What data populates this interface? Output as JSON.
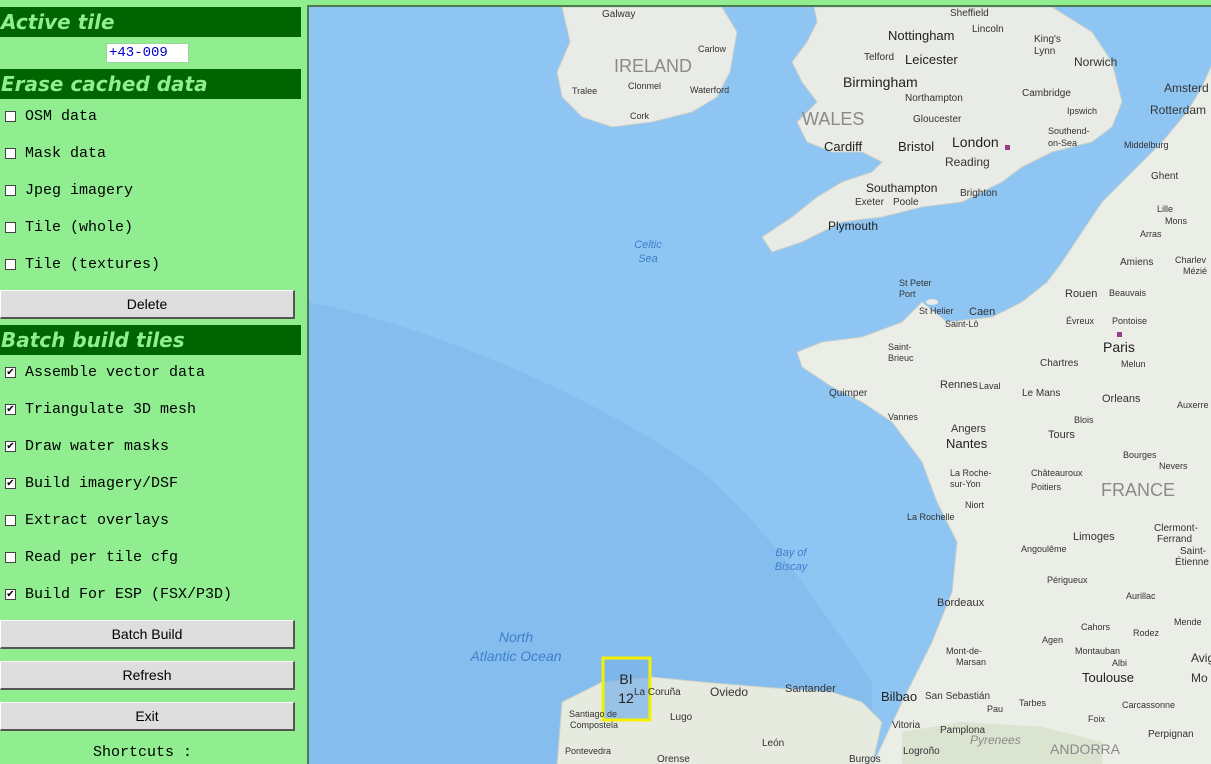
{
  "sidebar": {
    "active_tile": {
      "header": "Active tile",
      "value": "+43-009"
    },
    "erase": {
      "header": "Erase cached data",
      "options": [
        {
          "label": "OSM data",
          "checked": false
        },
        {
          "label": "Mask data",
          "checked": false
        },
        {
          "label": "Jpeg imagery",
          "checked": false
        },
        {
          "label": "Tile (whole)",
          "checked": false
        },
        {
          "label": "Tile (textures)",
          "checked": false
        }
      ],
      "delete_label": "Delete"
    },
    "batch": {
      "header": "Batch build tiles",
      "options": [
        {
          "label": "Assemble vector data",
          "checked": true
        },
        {
          "label": "Triangulate 3D mesh",
          "checked": true
        },
        {
          "label": "Draw water masks",
          "checked": true
        },
        {
          "label": "Build imagery/DSF",
          "checked": true
        },
        {
          "label": "Extract overlays",
          "checked": false
        },
        {
          "label": "Read per tile cfg",
          "checked": false
        },
        {
          "label": "Build For ESP (FSX/P3D)",
          "checked": true
        }
      ],
      "batch_build_label": "Batch Build",
      "refresh_label": "Refresh",
      "exit_label": "Exit"
    },
    "shortcuts_label": "Shortcuts :"
  },
  "map": {
    "selected_tile": {
      "line1": "BI",
      "line2": "12"
    },
    "water_labels": {
      "celtic1": "Celtic",
      "celtic2": "Sea",
      "biscay1": "Bay of",
      "biscay2": "Biscay",
      "atlantic1": "North",
      "atlantic2": "Atlantic Ocean"
    },
    "country_labels": {
      "ireland": "IRELAND",
      "wales": "WALES",
      "france": "FRANCE",
      "andorra": "ANDORRA"
    },
    "region_labels": {
      "pyrenees": "Pyrenees"
    },
    "cities_big": {
      "london": "London",
      "birmingham": "Birmingham",
      "paris": "Paris",
      "nantes": "Nantes",
      "bilbao": "Bilbao",
      "toulouse": "Toulouse",
      "nottingham": "Nottingham",
      "leicester": "Leicester",
      "cardiff": "Cardiff",
      "bristol": "Bristol",
      "southampton": "Southampton",
      "plymouth": "Plymouth",
      "reading": "Reading",
      "rouen": "Rouen",
      "bordeaux": "Bordeaux",
      "rennes": "Rennes",
      "caen": "Caen",
      "orleans": "Orleans",
      "tours": "Tours",
      "limoges": "Limoges",
      "oviedo": "Oviedo",
      "santander": "Santander",
      "norwich": "Norwich",
      "angers": "Angers",
      "amsterdam": "Amsterd",
      "rotterdam": "Rotterdam",
      "mo": "Mo",
      "avig": "Avig"
    },
    "cities_small": {
      "galway": "Galway",
      "sheffield": "Sheffield",
      "lincoln": "Lincoln",
      "kingslynn1": "King's",
      "kingslynn2": "Lynn",
      "carlow": "Carlow",
      "telford": "Telford",
      "tralee": "Tralee",
      "clonmel": "Clonmel",
      "waterford": "Waterford",
      "northampton": "Northampton",
      "cambridge": "Cambridge",
      "ipswich": "Ipswich",
      "cork": "Cork",
      "gloucester": "Gloucester",
      "southend1": "Southend-",
      "southend2": "on-Sea",
      "middelburg": "Middelburg",
      "ghent": "Ghent",
      "brighton": "Brighton",
      "exeter": "Exeter",
      "poole": "Poole",
      "lille": "Lille",
      "mons": "Mons",
      "arras": "Arras",
      "amiens": "Amiens",
      "charleville1": "Charlev",
      "charleville2": "Mézié",
      "stpeter1": "St Peter",
      "stpeter2": "Port",
      "sthelier": "St Helier",
      "stlo": "Saint-Lô",
      "beauvais": "Beauvais",
      "evreux": "Évreux",
      "pontoise": "Pontoise",
      "stbrieuc1": "Saint-",
      "stbrieuc2": "Brieuc",
      "chartres": "Chartres",
      "melun": "Melun",
      "quimper": "Quimper",
      "laval": "Laval",
      "lemans": "Le Mans",
      "auxerre": "Auxerre",
      "vannes": "Vannes",
      "blois": "Blois",
      "bourges": "Bourges",
      "nevers": "Nevers",
      "larochesuryon1": "La Roche-",
      "larochesuryon2": "sur-Yon",
      "chateauroux1": "Châteauroux",
      "chateauroux2": "Poitiers",
      "niort": "Niort",
      "larochelle": "La Rochelle",
      "clermont1": "Clermont-",
      "clermont2": "Ferrand",
      "angouleme": "Angoulême",
      "stetienne1": "Saint-",
      "stetienne2": "Étienne",
      "perigueux": "Périgueux",
      "aurillac": "Aurillac",
      "mende": "Mende",
      "agen": "Agen",
      "cahors": "Cahors",
      "rodez": "Rodez",
      "montdemarsan1": "Mont-de-",
      "montdemarsan2": "Marsan",
      "montauban": "Montauban",
      "albi": "Albi",
      "lacoruna": "La Coruña",
      "santiago1": "Santiago de",
      "santiago2": "Compostela",
      "lugo": "Lugo",
      "sansebastian": "San Sebastián",
      "pau": "Pau",
      "tarbes": "Tarbes",
      "foix": "Foix",
      "carcassonne": "Carcassonne",
      "vitoria": "Vitoria",
      "pamplona": "Pamplona",
      "pontevedra": "Pontevedra",
      "leon": "León",
      "orense": "Orense",
      "burgos": "Burgos",
      "logrono": "Logroño",
      "perpignan": "Perpignan"
    }
  }
}
